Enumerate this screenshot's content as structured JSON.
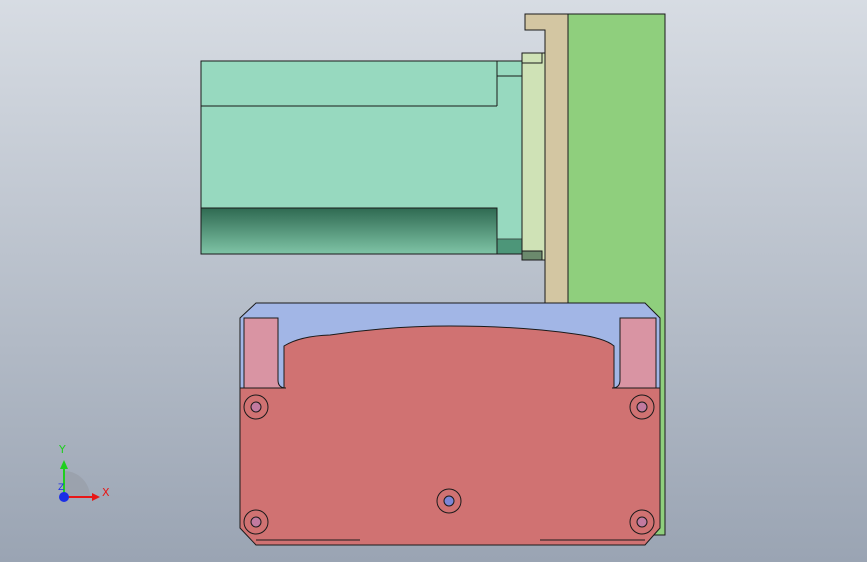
{
  "viewport": {
    "background_top": "#d7dce3",
    "background_bottom": "#9aa4b3"
  },
  "parts": {
    "motor_body_color": "#97d9bf",
    "motor_shadow_color": "#2f7a5c",
    "mount_plate_color": "#d3c6a2",
    "flange_color": "#cfe2b6",
    "back_plate_color": "#8fcf7d",
    "housing_top_color": "#a2b6e6",
    "housing_body_color": "#d07272",
    "housing_pocket_color": "#d994a3"
  },
  "triad": {
    "x_label": "X",
    "y_label": "Y",
    "z_label": "Z",
    "x_color": "#e81616",
    "y_color": "#1fcf1f",
    "z_color": "#1a2ee6"
  }
}
